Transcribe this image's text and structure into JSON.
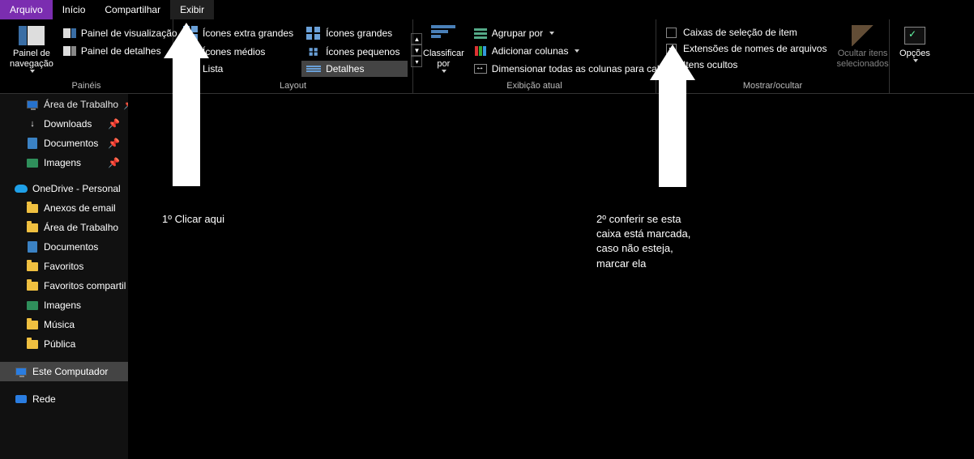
{
  "tabs": {
    "file": "Arquivo",
    "home": "Início",
    "share": "Compartilhar",
    "view": "Exibir"
  },
  "panels": {
    "navpane": "Painel de\nnavegação",
    "preview": "Painel de visualização",
    "details": "Painel de detalhes",
    "group_label": "Painéis"
  },
  "layout": {
    "extra_large": "Ícones extra grandes",
    "large": "Ícones grandes",
    "medium": "Ícones médios",
    "small": "Ícones pequenos",
    "list": "Lista",
    "details_view": "Detalhes",
    "group_label": "Layout"
  },
  "current_view": {
    "sort_by": "Classificar\npor",
    "group_by": "Agrupar por",
    "add_columns": "Adicionar colunas",
    "fit_columns": "Dimensionar todas as colunas para caber",
    "group_label": "Exibição atual"
  },
  "show_hide": {
    "item_checkboxes": "Caixas de seleção de item",
    "file_ext": "Extensões de nomes de arquivos",
    "hidden_items": "Itens ocultos",
    "hide_selected": "Ocultar itens\nselecionados",
    "options": "Opções",
    "group_label": "Mostrar/ocultar",
    "checked_item_checkboxes": false,
    "checked_file_ext": true,
    "checked_hidden_items": false
  },
  "tree": {
    "area_trabalho": "Área de Trabalho",
    "downloads": "Downloads",
    "documentos": "Documentos",
    "imagens": "Imagens",
    "onedrive": "OneDrive - Personal",
    "anexos": "Anexos de email",
    "area_trabalho2": "Área de Trabalho",
    "documentos2": "Documentos",
    "favoritos": "Favoritos",
    "favoritos_comp": "Favoritos compartil",
    "imagens2": "Imagens",
    "musica": "Música",
    "publica": "Pública",
    "este_computador": "Este Computador",
    "rede": "Rede"
  },
  "annotations": {
    "step1": "1º Clicar aqui",
    "step2": "2º conferir se esta\ncaixa está marcada,\ncaso não esteja,\nmarcar ela"
  }
}
